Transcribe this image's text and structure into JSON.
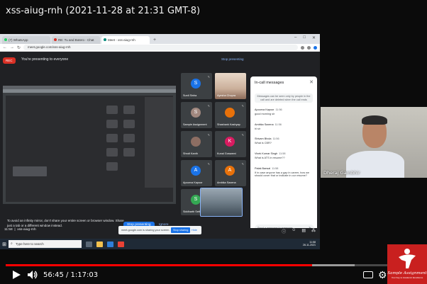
{
  "video": {
    "title": "xss-aiug-rnh (2021-11-28 at 21:31 GMT-8)",
    "current_time": "56:45",
    "duration": "1:17:03",
    "time_display": "56:45 / 1:17:03",
    "progress_fraction": 0.737
  },
  "browser": {
    "tabs": [
      {
        "label": "(7) WhatsApp",
        "color": "#25d366"
      },
      {
        "label": "RE: Tu and Botero - Chat",
        "color": "#d93025"
      },
      {
        "label": "Meet - xss-aiug-rnh",
        "color": "#00897b",
        "active": true
      }
    ],
    "url": "meet.google.com/xss-aiug-rnh"
  },
  "meet": {
    "rec_label": "REC",
    "presenting_text": "You're presenting to everyone",
    "stop_presenting_top": "Stop presenting",
    "infinity_warning": "To avoid an infinity mirror, don't share your entire screen or browser window. Share just a tab or a different window instead.",
    "stop_presenting_button": "Stop presenting",
    "ignore_button": "Ignore",
    "time": "11:58",
    "meeting_code": "xss-aiug-rnh",
    "share_bar_text": "meet.google.com is sharing your screen.",
    "share_stop": "Stop sharing",
    "share_hide": "Hide",
    "participants": [
      {
        "name": "Sunil Sinha",
        "initial": "S",
        "color": "#1a73e8"
      },
      {
        "name": "Ayesha Chopra",
        "photo": true
      },
      {
        "name": "Sample Assignment",
        "initial": "S",
        "color": "#a1887f"
      },
      {
        "name": "Shashank Kashyap",
        "initial": "",
        "color": "#e8710a"
      },
      {
        "name": "Shruti Kanth",
        "initial": "",
        "color": "#8d6e63"
      },
      {
        "name": "Kunal Goswami",
        "initial": "K",
        "color": "#d81b60"
      },
      {
        "name": "Apoorva Kapoor",
        "initial": "A",
        "color": "#1a73e8"
      },
      {
        "name": "Ambika Saxena",
        "initial": "A",
        "color": "#e8710a"
      },
      {
        "name": "Siddharth Sethi",
        "initial": "S",
        "color": "#34a853"
      },
      {
        "name": "",
        "photo": true,
        "man": true
      }
    ]
  },
  "chat": {
    "title": "In-call messages",
    "note": "Messages can be seen only by people in the call and are deleted when the call ends",
    "messages": [
      {
        "sender": "Apoorva Kapoor",
        "time": "11:56",
        "text": "good morning sir"
      },
      {
        "sender": "Ambika Saxena",
        "time": "11:56",
        "text": "hi sir"
      },
      {
        "sender": "Shivam Bhola",
        "time": "11:56",
        "text": "What is CBR?"
      },
      {
        "sender": "Vivek Kumar Singh",
        "time": "11:58",
        "text": "What is ATS in resume??"
      },
      {
        "sender": "Palak Bansal",
        "time": "11:58",
        "text": "If in case anyone has a gap in career, how we should cover that or indicate in our resume?"
      }
    ],
    "send_placeholder": "Send a message to everyone"
  },
  "taskbar": {
    "search_placeholder": "Type here to search",
    "clock": "11:58",
    "date": "28-11-2021"
  },
  "webcam": {
    "name": "Dheraj Gambhir"
  },
  "logo": {
    "name": "Sample Assignment",
    "tagline": "Your Key to Academic Excellence"
  },
  "colors": {
    "progress_red": "#ff0000",
    "meet_dark": "#202124",
    "brand_red": "#c9201f"
  }
}
